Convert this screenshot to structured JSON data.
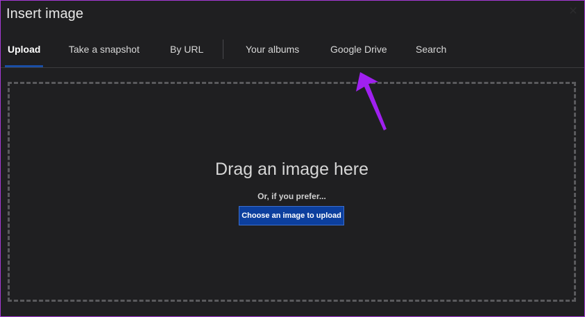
{
  "dialog": {
    "title": "Insert image",
    "close_icon": "close-icon"
  },
  "tabs": [
    {
      "label": "Upload",
      "active": true
    },
    {
      "label": "Take a snapshot",
      "active": false
    },
    {
      "label": "By URL",
      "active": false
    },
    {
      "label": "Your albums",
      "active": false
    },
    {
      "label": "Google Drive",
      "active": false
    },
    {
      "label": "Search",
      "active": false
    }
  ],
  "drop_zone": {
    "heading": "Drag an image here",
    "subtext": "Or, if you prefer...",
    "button_label": "Choose an image to upload"
  },
  "colors": {
    "background": "#1f1f21",
    "accent": "#1a4fa6",
    "button": "#0c3f9e",
    "annotation": "#a020f0"
  }
}
